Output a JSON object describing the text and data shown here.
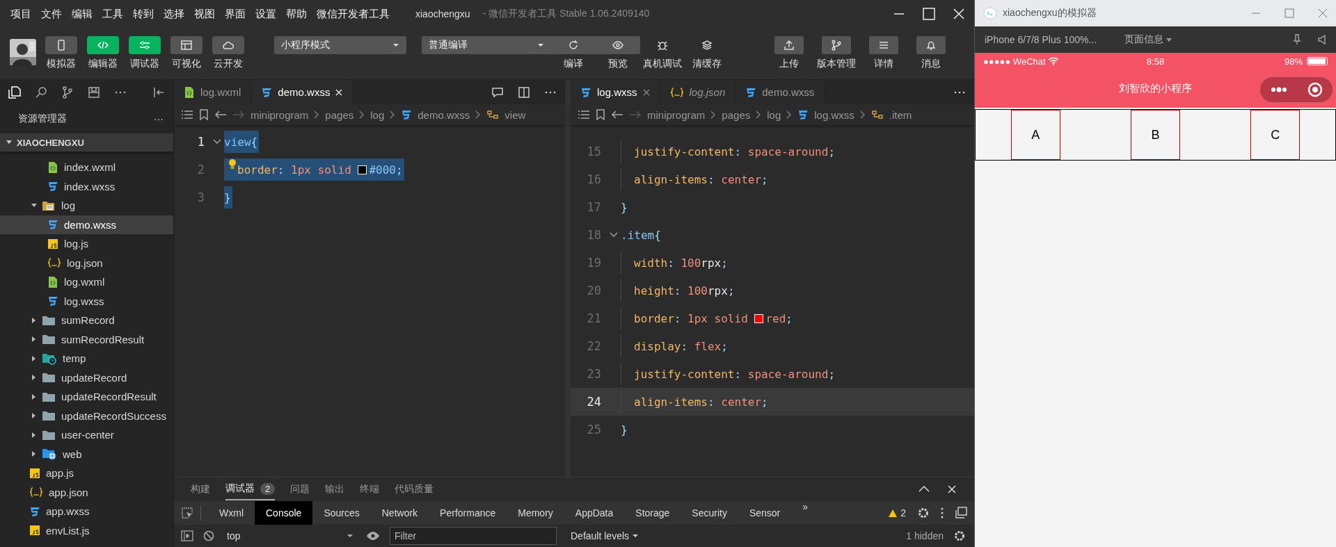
{
  "menu": [
    "项目",
    "文件",
    "编辑",
    "工具",
    "转到",
    "选择",
    "视图",
    "界面",
    "设置",
    "帮助",
    "微信开发者工具"
  ],
  "window": {
    "project": "xiaochengxu",
    "title": "- 微信开发者工具 Stable 1.06.2409140"
  },
  "toolbar": {
    "view_buttons": [
      {
        "label": "模拟器",
        "kind": "phone",
        "on": false
      },
      {
        "label": "编辑器",
        "kind": "code",
        "on": true
      },
      {
        "label": "调试器",
        "kind": "sliders",
        "on": true
      },
      {
        "label": "可视化",
        "kind": "layout",
        "on": false
      },
      {
        "label": "云开发",
        "kind": "cloud",
        "on": false
      }
    ],
    "mode_select": "小程序模式",
    "compile_select": "普通编译",
    "actions": [
      {
        "label": "编译",
        "kind": "refresh"
      },
      {
        "label": "预览",
        "kind": "eye"
      },
      {
        "label": "真机调试",
        "kind": "bug"
      },
      {
        "label": "清缓存",
        "kind": "layers"
      }
    ],
    "right_actions": [
      {
        "label": "上传",
        "kind": "upload"
      },
      {
        "label": "版本管理",
        "kind": "branch"
      },
      {
        "label": "详情",
        "kind": "menu"
      },
      {
        "label": "消息",
        "kind": "bell"
      }
    ]
  },
  "sidebar": {
    "title": "资源管理器",
    "more": "···",
    "root": "XIAOCHENGXU",
    "root_expanded": true,
    "tree": [
      {
        "children": [
          {
            "label": "index.wxml",
            "kind": "wxml",
            "selected": false
          },
          {
            "label": "index.wxss",
            "kind": "wxss",
            "selected": false
          }
        ]
      },
      {
        "label": "log",
        "kind": "folder-open",
        "expanded": true,
        "selected": false,
        "children": [
          {
            "label": "demo.wxss",
            "kind": "wxss",
            "selected": true
          },
          {
            "label": "log.js",
            "kind": "js",
            "selected": false
          },
          {
            "label": "log.json",
            "kind": "json",
            "selected": false
          },
          {
            "label": "log.wxml",
            "kind": "wxml",
            "selected": false
          },
          {
            "label": "log.wxss",
            "kind": "wxss",
            "selected": false
          }
        ]
      },
      {
        "label": "sumRecord",
        "kind": "folder",
        "expanded": false,
        "selected": false
      },
      {
        "label": "sumRecordResult",
        "kind": "folder",
        "expanded": false,
        "selected": false
      },
      {
        "label": "temp",
        "kind": "folder-clock",
        "expanded": false,
        "selected": false
      },
      {
        "label": "updateRecord",
        "kind": "folder",
        "expanded": false,
        "selected": false
      },
      {
        "label": "updateRecordResult",
        "kind": "folder",
        "expanded": false,
        "selected": false
      },
      {
        "label": "updateRecordSuccess",
        "kind": "folder",
        "expanded": false,
        "selected": false
      },
      {
        "label": "user-center",
        "kind": "folder",
        "expanded": false,
        "selected": false
      },
      {
        "label": "web",
        "kind": "folder-globe",
        "expanded": false,
        "selected": false
      },
      {
        "label": "app.js",
        "kind": "js",
        "selected": false
      },
      {
        "label": "app.json",
        "kind": "json",
        "selected": false
      },
      {
        "label": "app.wxss",
        "kind": "wxss",
        "selected": false
      },
      {
        "label": "envList.js",
        "kind": "js",
        "selected": false
      }
    ]
  },
  "editors": [
    {
      "tabs": [
        {
          "label": "log.wxml",
          "kind": "wxml",
          "selected": false,
          "preview": false
        },
        {
          "label": "demo.wxss",
          "kind": "wxss",
          "selected": true,
          "preview": false
        }
      ],
      "breadcrumb": [
        {
          "label": "miniprogram",
          "kind": "text"
        },
        {
          "label": "pages",
          "kind": "text"
        },
        {
          "label": "log",
          "kind": "text"
        },
        {
          "label": "demo.wxss",
          "kind": "wxss"
        },
        {
          "label": "view",
          "kind": "symbol"
        }
      ],
      "lines": [
        {
          "number": "1",
          "indented": false,
          "gutter_icon": {
            "kind": "fold"
          },
          "selected": true,
          "current": true,
          "tokens": [
            {
              "kind": "selector",
              "text": "view"
            },
            {
              "kind": "punct",
              "text": "{"
            }
          ]
        },
        {
          "number": "2",
          "indented": true,
          "gutter_icon": {
            "kind": "bulb"
          },
          "selected": true,
          "current": false,
          "tokens": [
            {
              "kind": "property",
              "text": "border"
            },
            {
              "kind": "punct",
              "text": ":"
            },
            {
              "kind": "value",
              "text": " 1px solid "
            },
            {
              "kind": "swatch",
              "color": "#000000"
            },
            {
              "kind": "hex",
              "text": "#000"
            },
            {
              "kind": "punct",
              "text": ";"
            }
          ]
        },
        {
          "number": "3",
          "indented": false,
          "selected": true,
          "current": false,
          "tokens": [
            {
              "kind": "punct",
              "text": "}"
            }
          ]
        }
      ]
    },
    {
      "tabs": [
        {
          "label": "log.wxss",
          "kind": "wxss",
          "selected": true,
          "preview": false
        },
        {
          "label": "log.json",
          "kind": "json",
          "selected": false,
          "preview": true
        },
        {
          "label": "demo.wxss",
          "kind": "wxss",
          "selected": false,
          "preview": false
        }
      ],
      "breadcrumb": [
        {
          "label": "miniprogram",
          "kind": "text"
        },
        {
          "label": "pages",
          "kind": "text"
        },
        {
          "label": "log",
          "kind": "text"
        },
        {
          "label": "log.wxss",
          "kind": "wxss"
        },
        {
          "label": ".item",
          "kind": "symbol"
        }
      ],
      "lines": [
        {
          "number": "15",
          "indented": true,
          "selected": false,
          "current": false,
          "tokens": [
            {
              "kind": "property",
              "text": "justify-content"
            },
            {
              "kind": "punct",
              "text": ":"
            },
            {
              "kind": "value",
              "text": " space-around"
            },
            {
              "kind": "punct",
              "text": ";"
            }
          ]
        },
        {
          "number": "16",
          "indented": true,
          "selected": false,
          "current": false,
          "tokens": [
            {
              "kind": "property",
              "text": "align-items"
            },
            {
              "kind": "punct",
              "text": ":"
            },
            {
              "kind": "value",
              "text": " center"
            },
            {
              "kind": "punct",
              "text": ";"
            }
          ]
        },
        {
          "number": "17",
          "indented": false,
          "selected": false,
          "current": false,
          "tokens": [
            {
              "kind": "punct",
              "text": "}"
            }
          ]
        },
        {
          "number": "18",
          "indented": false,
          "gutter_icon": {
            "kind": "fold"
          },
          "selected": false,
          "current": false,
          "tokens": [
            {
              "kind": "selector",
              "text": ".item"
            },
            {
              "kind": "punct",
              "text": "{"
            }
          ]
        },
        {
          "number": "19",
          "indented": true,
          "selected": false,
          "current": false,
          "tokens": [
            {
              "kind": "property",
              "text": "width"
            },
            {
              "kind": "punct",
              "text": ":"
            },
            {
              "kind": "value",
              "text": " 100"
            },
            {
              "kind": "unit",
              "text": "rpx"
            },
            {
              "kind": "punct",
              "text": ";"
            }
          ]
        },
        {
          "number": "20",
          "indented": true,
          "selected": false,
          "current": false,
          "tokens": [
            {
              "kind": "property",
              "text": "height"
            },
            {
              "kind": "punct",
              "text": ":"
            },
            {
              "kind": "value",
              "text": " 100"
            },
            {
              "kind": "unit",
              "text": "rpx"
            },
            {
              "kind": "punct",
              "text": ";"
            }
          ]
        },
        {
          "number": "21",
          "indented": true,
          "selected": false,
          "current": false,
          "tokens": [
            {
              "kind": "property",
              "text": "border"
            },
            {
              "kind": "punct",
              "text": ":"
            },
            {
              "kind": "value",
              "text": " 1px solid "
            },
            {
              "kind": "swatch",
              "color": "#ff0000"
            },
            {
              "kind": "value",
              "text": "red"
            },
            {
              "kind": "punct",
              "text": ";"
            }
          ]
        },
        {
          "number": "22",
          "indented": true,
          "selected": false,
          "current": false,
          "tokens": [
            {
              "kind": "property",
              "text": "display"
            },
            {
              "kind": "punct",
              "text": ":"
            },
            {
              "kind": "value",
              "text": " flex"
            },
            {
              "kind": "punct",
              "text": ";"
            }
          ]
        },
        {
          "number": "23",
          "indented": true,
          "selected": false,
          "current": false,
          "tokens": [
            {
              "kind": "property",
              "text": "justify-content"
            },
            {
              "kind": "punct",
              "text": ":"
            },
            {
              "kind": "value",
              "text": " space-around"
            },
            {
              "kind": "punct",
              "text": ";"
            }
          ]
        },
        {
          "number": "24",
          "indented": true,
          "selected": false,
          "current": true,
          "tokens": [
            {
              "kind": "property",
              "text": "align-items"
            },
            {
              "kind": "punct",
              "text": ":"
            },
            {
              "kind": "value",
              "text": " center"
            },
            {
              "kind": "punct",
              "text": ";"
            }
          ]
        },
        {
          "number": "25",
          "indented": false,
          "selected": false,
          "current": false,
          "tokens": [
            {
              "kind": "punct",
              "text": "}"
            }
          ]
        }
      ]
    }
  ],
  "panel": {
    "tabs": [
      {
        "label": "构建",
        "selected": false
      },
      {
        "label": "调试器",
        "selected": true,
        "badge": "2"
      },
      {
        "label": "问题",
        "selected": false
      },
      {
        "label": "输出",
        "selected": false
      },
      {
        "label": "终端",
        "selected": false
      },
      {
        "label": "代码质量",
        "selected": false
      }
    ],
    "devtools_tabs": [
      {
        "label": "Wxml",
        "selected": false
      },
      {
        "label": "Console",
        "selected": true
      },
      {
        "label": "Sources",
        "selected": false
      },
      {
        "label": "Network",
        "selected": false
      },
      {
        "label": "Performance",
        "selected": false
      },
      {
        "label": "Memory",
        "selected": false
      },
      {
        "label": "AppData",
        "selected": false
      },
      {
        "label": "Storage",
        "selected": false
      },
      {
        "label": "Security",
        "selected": false
      },
      {
        "label": "Sensor",
        "selected": false
      }
    ],
    "overflow": "»",
    "warnings": "2",
    "console": {
      "context": "top",
      "filter_placeholder": "Filter",
      "levels": "Default levels",
      "hidden": "1 hidden"
    }
  },
  "simulator": {
    "title": "xiaochengxu的模拟器",
    "device": "iPhone 6/7/8 Plus 100%...",
    "page_info": "页面信息",
    "status": {
      "carrier": "●●●●● WeChat",
      "time": "8:58",
      "battery": "98%"
    },
    "nav_title": "刘智欣的小程序",
    "items": [
      "A",
      "B",
      "C"
    ]
  }
}
